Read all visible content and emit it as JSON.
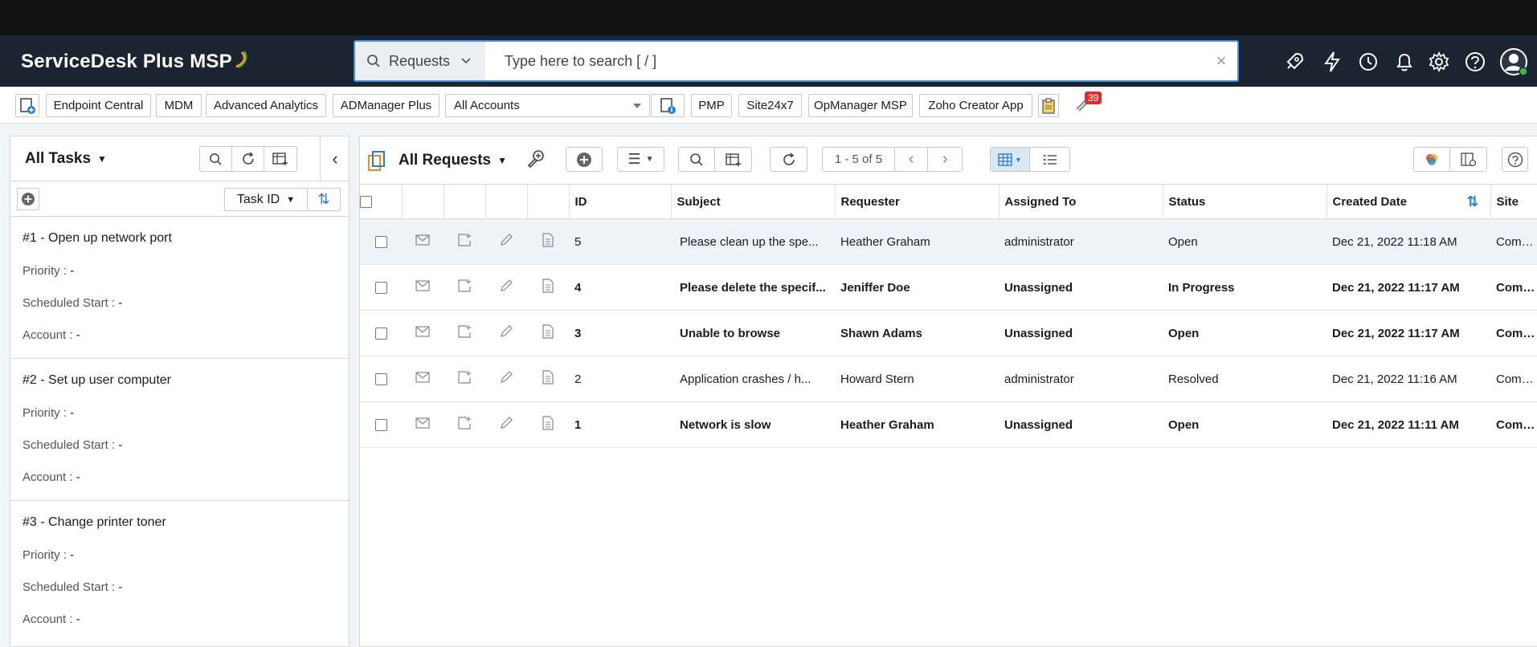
{
  "app": {
    "logo_text": "ServiceDesk Plus MSP"
  },
  "search": {
    "scope": "Requests",
    "placeholder": "Type here to search [ / ]"
  },
  "quickbar": {
    "items": [
      "Endpoint Central",
      "MDM",
      "Advanced Analytics",
      "ADManager Plus",
      "PMP",
      "Site24x7",
      "OpManager MSP",
      "Zoho Creator App"
    ],
    "account_select": "All Accounts",
    "notification_count": "39"
  },
  "tasks": {
    "view_label": "All Tasks",
    "sort_field": "Task ID",
    "list": [
      {
        "title": "#1 - Open up network port",
        "priority_label": "Priority :",
        "priority": "-",
        "start_label": "Scheduled Start :",
        "start": "-",
        "account_label": "Account :",
        "account": "-"
      },
      {
        "title": "#2 - Set up user computer",
        "priority_label": "Priority :",
        "priority": "-",
        "start_label": "Scheduled Start :",
        "start": "-",
        "account_label": "Account :",
        "account": "-"
      },
      {
        "title": "#3 - Change printer toner",
        "priority_label": "Priority :",
        "priority": "-",
        "start_label": "Scheduled Start :",
        "start": "-",
        "account_label": "Account :",
        "account": "-"
      }
    ]
  },
  "requests": {
    "view_label": "All Requests",
    "pager": "1 - 5 of 5",
    "columns": {
      "id": "ID",
      "subject": "Subject",
      "requester": "Requester",
      "assigned": "Assigned To",
      "status": "Status",
      "created": "Created Date",
      "site": "Site"
    },
    "rows": [
      {
        "id": "5",
        "subject": "Please clean up the spe...",
        "requester": "Heather Graham",
        "assigned": "administrator",
        "status": "Open",
        "created": "Dec 21, 2022 11:18 AM",
        "site": "Comme"
      },
      {
        "id": "4",
        "subject": "Please delete the specif...",
        "requester": "Jeniffer Doe",
        "assigned": "Unassigned",
        "status": "In Progress",
        "created": "Dec 21, 2022 11:17 AM",
        "site": "Comme"
      },
      {
        "id": "3",
        "subject": "Unable to browse",
        "requester": "Shawn Adams",
        "assigned": "Unassigned",
        "status": "Open",
        "created": "Dec 21, 2022 11:17 AM",
        "site": "Comme"
      },
      {
        "id": "2",
        "subject": "Application crashes / h...",
        "requester": "Howard Stern",
        "assigned": "administrator",
        "status": "Resolved",
        "created": "Dec 21, 2022 11:16 AM",
        "site": "Comme"
      },
      {
        "id": "1",
        "subject": "Network is slow",
        "requester": "Heather Graham",
        "assigned": "Unassigned",
        "status": "Open",
        "created": "Dec 21, 2022 11:11 AM",
        "site": "Comme"
      }
    ]
  }
}
